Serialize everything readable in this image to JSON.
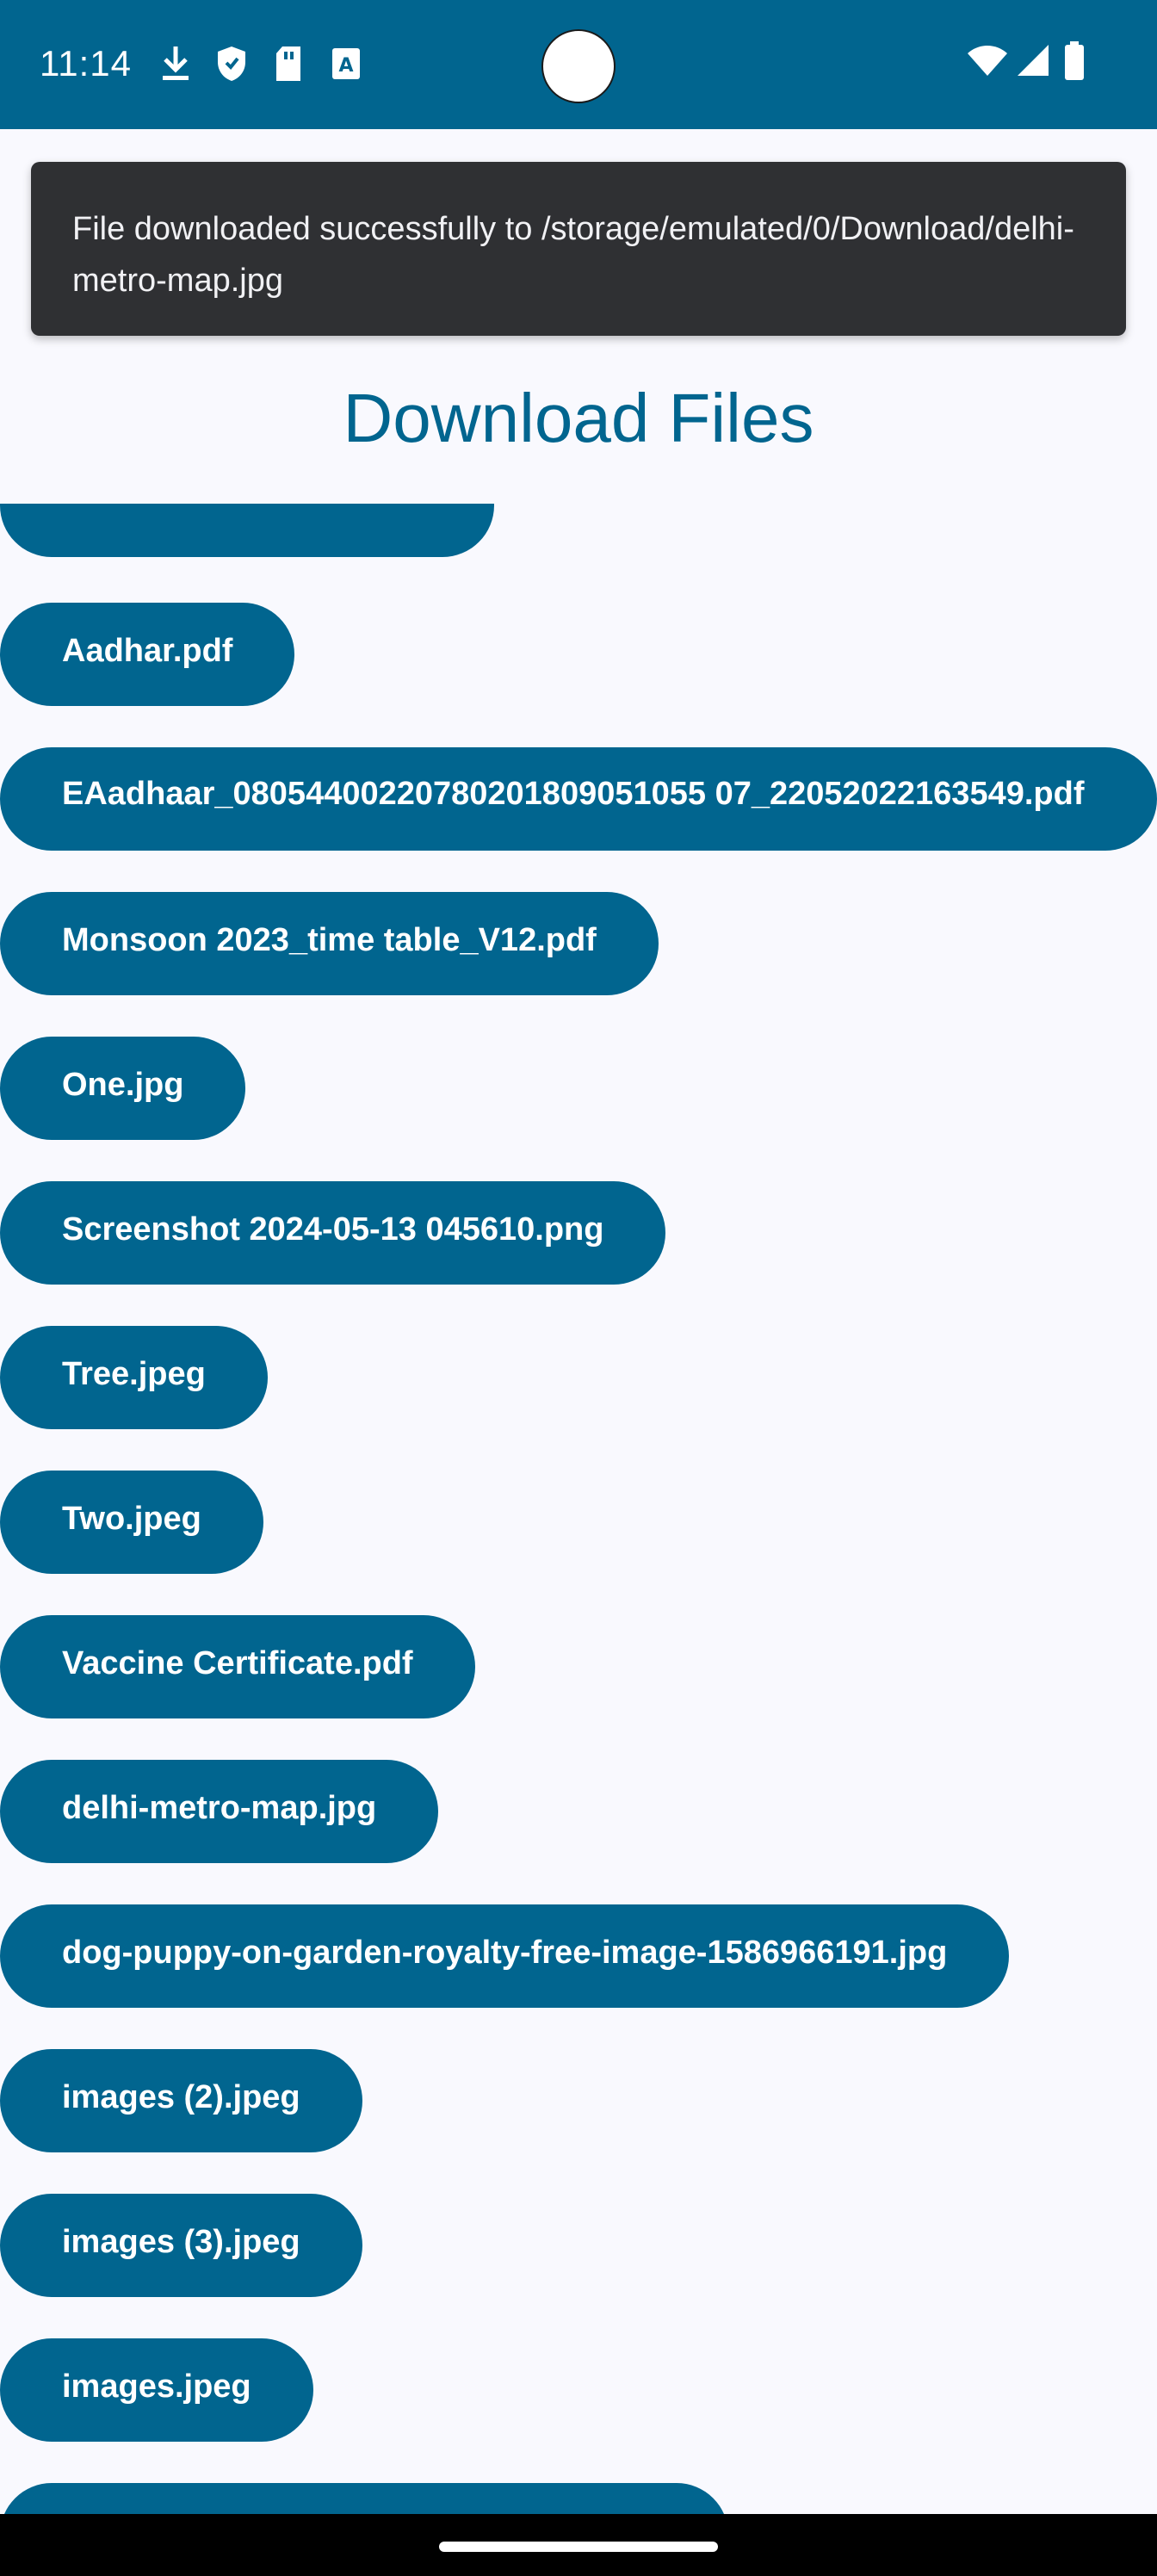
{
  "status_bar": {
    "time": "11:14",
    "left_icons": [
      "download-icon",
      "shield-icon",
      "sd-card-icon",
      "font-a-icon"
    ],
    "right_icons": [
      "wifi-icon",
      "signal-icon",
      "battery-icon"
    ],
    "color": "#01658f"
  },
  "toast": {
    "message": "File downloaded successfully to /storage/emulated/0/Download/delhi-metro-map.jpg"
  },
  "title": "Download Files",
  "files": [
    {
      "label": ""
    },
    {
      "label": "Aadhar.pdf"
    },
    {
      "label": "EAadhaar_08054400220780201809051055 07_22052022163549.pdf"
    },
    {
      "label": "Monsoon 2023_time table_V12.pdf"
    },
    {
      "label": "One.jpg"
    },
    {
      "label": "Screenshot 2024-05-13 045610.png"
    },
    {
      "label": "Tree.jpeg"
    },
    {
      "label": "Two.jpeg"
    },
    {
      "label": "Vaccine Certificate.pdf"
    },
    {
      "label": "delhi-metro-map.jpg"
    },
    {
      "label": "dog-puppy-on-garden-royalty-free-image-1586966191.jpg"
    },
    {
      "label": "images (2).jpeg"
    },
    {
      "label": "images (3).jpeg"
    },
    {
      "label": "images.jpeg"
    },
    {
      "label": ""
    }
  ],
  "colors": {
    "accent": "#01658f",
    "background": "#f9f9fe",
    "toast": "#2f3033"
  }
}
